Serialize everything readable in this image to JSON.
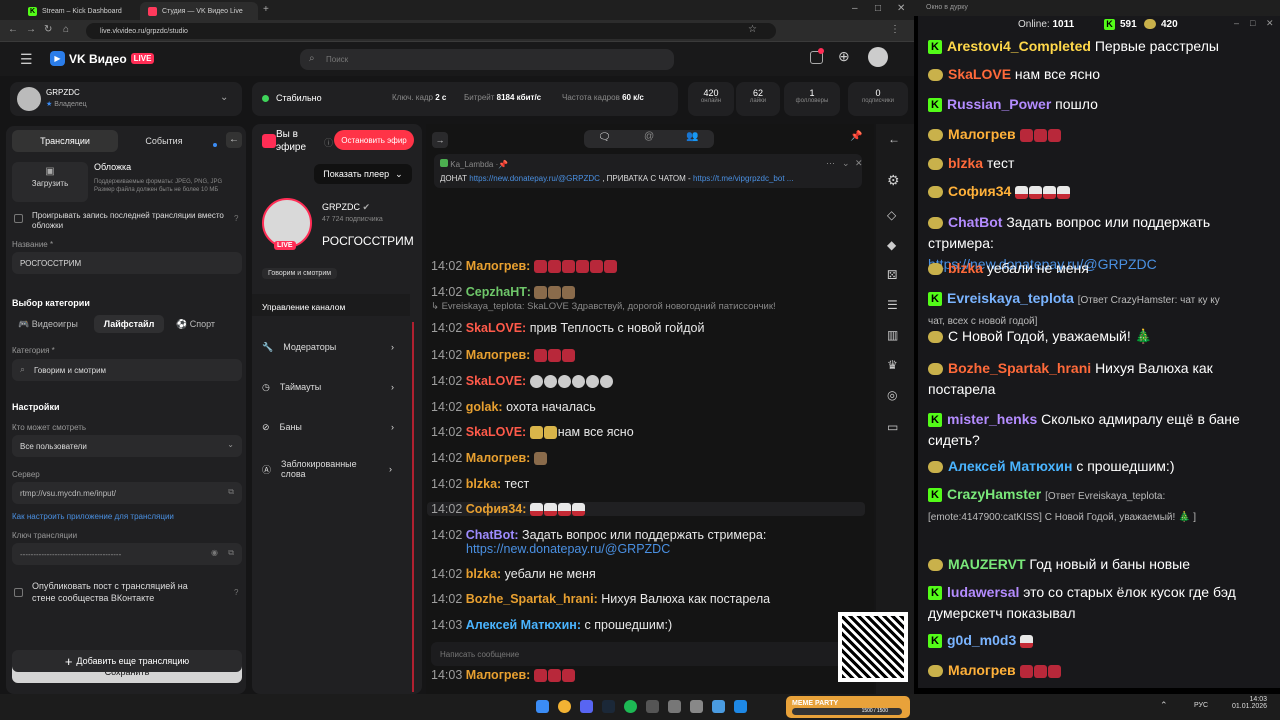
{
  "browser": {
    "tabs": [
      "Stream – Kick Dashboard",
      "Студия — VK Видео Live"
    ],
    "url": "live.vkvideo.ru/grpzdc/studio"
  },
  "vk": {
    "logo": "VK Видео",
    "live": "LIVE",
    "search_placeholder": "Поиск",
    "account": {
      "name": "GRPZDC",
      "role": "Владелец"
    },
    "status": "Стабильно",
    "stats": [
      {
        "label": "Ключ. кадр",
        "value": "2 с"
      },
      {
        "label": "Битрейт",
        "value": "8184 кбит/с"
      },
      {
        "label": "Частота кадров",
        "value": "60 к/с"
      }
    ],
    "counters": [
      {
        "value": "420",
        "label": "онлайн"
      },
      {
        "value": "62",
        "label": "лайки"
      },
      {
        "value": "1",
        "label": "фолловеры"
      },
      {
        "value": "0",
        "label": "подписчики"
      }
    ],
    "tabs": {
      "streams": "Трансляции",
      "events": "События"
    },
    "cover": {
      "title": "Обложка",
      "upload": "Загрузить",
      "hint": "Поддерживаемые форматы: JPEG, PNG, JPG Размер файла должен быть не более 10 МБ"
    },
    "record_label": "Проигрывать запись последней трансляции вместо обложки",
    "name_label": "Название *",
    "name_value": "РОСГОССТРИМ",
    "category_choice": "Выбор категории",
    "cat_tabs": [
      "Видеоигры",
      "Лайфстайл",
      "Спорт"
    ],
    "category_label": "Категория *",
    "category_value": "Говорим и смотрим",
    "settings": "Настройки",
    "who_label": "Кто может смотреть",
    "who_value": "Все пользователи",
    "server_label": "Сервер",
    "server_value": "rtmp://vsu.mycdn.me/input/",
    "howto": "Как настроить приложение для трансляции",
    "key_label": "Ключ трансляции",
    "key_value": "--------------------------------------",
    "publish_label": "Опубликовать пост с трансляцией на стене сообщества ВКонтакте",
    "save": "Сохранить",
    "add": "Добавить еще трансляцию",
    "live_state": "Вы в эфире",
    "stop": "Остановить эфир",
    "show_player": "Показать плеер",
    "channel": {
      "name": "GRPZDC",
      "subs": "47 724 подписчика",
      "stream_title": "РОСГОССТРИМ",
      "category": "Говорим и смотрим"
    },
    "manage_title": "Управление каналом",
    "manage": [
      "Модераторы",
      "Таймауты",
      "Баны",
      "Заблокированные слова"
    ],
    "pinned": {
      "user": "Ka_Lambda",
      "text": "ДОНАТ",
      "link1": "https://new.donatepay.ru/@GRPZDC",
      "mid": ", ПРИВАТКА С ЧАТОМ -",
      "link2": "https://t.me/vipgrpzdc_bot ..."
    },
    "chat_placeholder": "Написать сообщение",
    "chat": [
      {
        "t": "14:02",
        "u": "Малогрев:",
        "c": "#e8a030",
        "txt": "",
        "emo": "red6"
      },
      {
        "t": "14:02",
        "u": "СерzhaНТ:",
        "c": "#6fc76a",
        "txt": "",
        "emo": "br3"
      },
      {
        "t": "14:02",
        "u": "SkaLOVE:",
        "c": "#ff5a4a",
        "txt": "прив Теплость",
        "tail": "с новой гойдой"
      },
      {
        "t": "14:02",
        "u": "Малогрев:",
        "c": "#e8a030",
        "txt": "",
        "emo": "red3"
      },
      {
        "t": "14:02",
        "u": "SkaLOVE:",
        "c": "#ff5a4a",
        "txt": "",
        "emo": "gr6"
      },
      {
        "t": "14:02",
        "u": "golak:",
        "c": "#e8a030",
        "txt": "охота началась"
      },
      {
        "t": "14:02",
        "u": "SkaLOVE:",
        "c": "#ff5a4a",
        "txt": "",
        "tail": "нам все ясно",
        "emo": "y2"
      },
      {
        "t": "14:02",
        "u": "Малогрев:",
        "c": "#e8a030",
        "txt": "",
        "emo": "br1"
      },
      {
        "t": "14:02",
        "u": "blzka:",
        "c": "#e8a030",
        "txt": "тест"
      },
      {
        "t": "14:02",
        "u": "София34:",
        "c": "#e8a030",
        "txt": "",
        "emo": "sant4"
      },
      {
        "t": "14:02",
        "u": "ChatBot:",
        "c": "#9e8cff",
        "txt": "Задать вопрос или поддержать стримера:",
        "link": "https://new.donatepay.ru/@GRPZDC"
      },
      {
        "t": "14:02",
        "u": "blzka:",
        "c": "#e8a030",
        "txt": "уебали не меня"
      },
      {
        "t": "14:02",
        "u": "Bozhe_Spartak_hrani:",
        "c": "#e8a030",
        "txt": "Нихуя Валюха как постарела"
      },
      {
        "t": "14:03",
        "u": "Алексей Матюхин:",
        "c": "#4ab4ff",
        "txt": "с прошедшим:)"
      },
      {
        "t": "14:03",
        "u": "MAUZERVT:",
        "c": "#6fc76a",
        "txt": "Год новый и баны новые"
      },
      {
        "t": "14:03",
        "u": "Малогрев:",
        "c": "#e8a030",
        "txt": "",
        "emo": "red3"
      }
    ],
    "reply_line": "Evreiskaya_teplota: SkaLOVE",
    "reply_text": "Здравствуй, дорогой новогодний патиссончик!"
  },
  "kick": {
    "window_title": "Окно в дурку",
    "online_label": "Online:",
    "online": "1011",
    "k_count": "591",
    "v_count": "420",
    "msgs": [
      {
        "p": "kick",
        "u": "Arestovi4_Completed",
        "c": "#ffd84a",
        "txt": "Первые расстрелы"
      },
      {
        "p": "vk",
        "u": "SkaLOVE",
        "c": "#ff6a3a",
        "txt": "нам все ясно"
      },
      {
        "p": "kick",
        "u": "Russian_Power",
        "c": "#b48cff",
        "txt": "пошло"
      },
      {
        "p": "vk",
        "u": "Малогрев",
        "c": "#ffb13a",
        "txt": ""
      },
      {
        "p": "vk",
        "u": "blzka",
        "c": "#ff6a3a",
        "txt": "тест"
      },
      {
        "p": "vk",
        "u": "София34",
        "c": "#ffb13a",
        "txt": ""
      },
      {
        "p": "vk",
        "u": "ChatBot",
        "c": "#b48cff",
        "txt": "Задать вопрос или поддержать",
        "cont": "стримера:",
        "link": "https://new.donatepay.ru/@GRPZDC"
      },
      {
        "p": "vk",
        "u": "blzka",
        "c": "#ff6a3a",
        "txt": "уебали не меня"
      },
      {
        "p": "kick",
        "u": "Evreiskaya_teplota",
        "c": "#7ab4ff",
        "reply": "[Ответ CrazyHamster: чат ку ку",
        "reply2": "чат, всех с новой годой]"
      },
      {
        "p": "vk",
        "u": "",
        "c": "#fff",
        "txt": "С Новой Годой, уважаемый! 🎄"
      },
      {
        "p": "vk",
        "u": "Bozhe_Spartak_hrani",
        "c": "#ff6a3a",
        "txt": "Нихуя Валюха как",
        "cont": "постарела"
      },
      {
        "p": "kick",
        "u": "mister_henks",
        "c": "#b48cff",
        "txt": "Сколько адмиралу ещё в бане",
        "cont": "сидеть?"
      },
      {
        "p": "vk",
        "u": "Алексей Матюхин",
        "c": "#4ab4ff",
        "txt": "с прошедшим:)"
      },
      {
        "p": "kick",
        "u": "CrazyHamster",
        "c": "#7ae87a",
        "reply": "[Ответ Evreiskaya_teplota:",
        "reply2": "[emote:4147900:catKISS] С Новой Годой, уважаемый! 🎄 ]"
      },
      {
        "p": "vk",
        "u": "MAUZERVT",
        "c": "#7ae87a",
        "txt": "Год новый и баны новые"
      },
      {
        "p": "kick",
        "u": "ludawersal",
        "c": "#b48cff",
        "txt": "это со старых ёлок кусок где бэд",
        "cont": "думерскетч показывал"
      },
      {
        "p": "kick",
        "u": "g0d_m0d3",
        "c": "#7ab4ff",
        "txt": ""
      },
      {
        "p": "vk",
        "u": "Малогрев",
        "c": "#ffb13a",
        "txt": ""
      }
    ]
  },
  "taskbar": {
    "lang": "РУС",
    "time": "14:03",
    "date": "01.01.2026",
    "meme": "MEME PARTY",
    "meme_bar": "1500 / 1500"
  }
}
